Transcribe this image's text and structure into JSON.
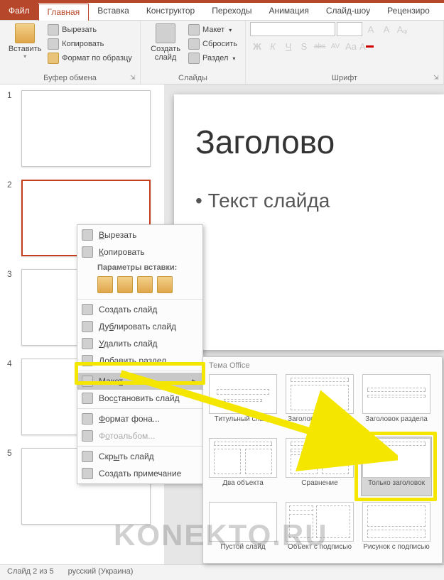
{
  "tabs": {
    "file": "Файл",
    "home": "Главная",
    "insert": "Вставка",
    "design": "Конструктор",
    "transitions": "Переходы",
    "animations": "Анимация",
    "slideshow": "Слайд-шоу",
    "review": "Рецензиро"
  },
  "ribbon": {
    "paste": "Вставить",
    "cut": "Вырезать",
    "copy": "Копировать",
    "format_painter": "Формат по образцу",
    "clipboard_group": "Буфер обмена",
    "new_slide_line1": "Создать",
    "new_slide_line2": "слайд",
    "layout": "Макет",
    "reset": "Сбросить",
    "section": "Раздел",
    "slides_group": "Слайды",
    "font_group": "Шрифт",
    "font_placeholder": " ",
    "size_placeholder": " ",
    "bold": "Ж",
    "italic": "К",
    "underline": "Ч",
    "shadow": "S",
    "strike": "abc",
    "spacing": "AV",
    "case": "Aa",
    "grow": "A",
    "shrink": "A",
    "clear": "Aᵩ"
  },
  "thumbs": [
    "1",
    "2",
    "3",
    "4",
    "5"
  ],
  "slide": {
    "title": "Заголово",
    "body": "• Текст слайда"
  },
  "status": {
    "counter": "Слайд 2 из 5",
    "lang": "русский (Украина)"
  },
  "ctx": {
    "cut": "Вырезать",
    "copy": "Копировать",
    "paste_header": "Параметры вставки:",
    "new_slide": "Создать слайд",
    "duplicate": "Дублировать слайд",
    "delete": "Удалить слайд",
    "add_section": "Добавить раздел",
    "layout": "Макет",
    "reset": "Восстановить слайд",
    "format_bg": "Формат фона...",
    "photo_album": "Фотоальбом...",
    "hide": "Скрыть слайд",
    "new_comment": "Создать примечание"
  },
  "gallery": {
    "title": "Тема Office",
    "items": [
      "Титульный слайд",
      "Заголовок и объект",
      "Заголовок раздела",
      "Два объекта",
      "Сравнение",
      "Только заголовок",
      "Пустой слайд",
      "Объект с подписью",
      "Рисунок с подписью"
    ]
  },
  "watermark": "KONEKTO.RU"
}
